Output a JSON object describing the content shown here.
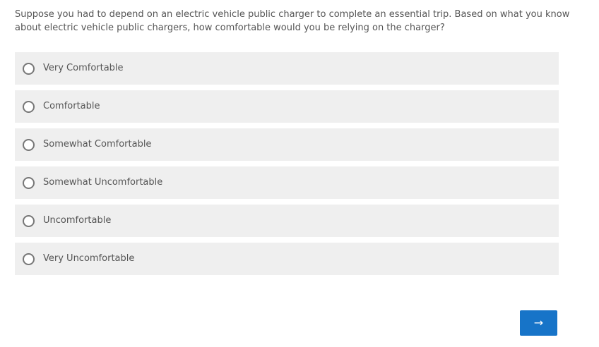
{
  "question": {
    "text": "Suppose you had to depend on an electric vehicle public charger to complete an essential trip. Based on what you know about electric vehicle public chargers, how comfortable would you be relying on the charger?"
  },
  "options": [
    {
      "label": "Very Comfortable"
    },
    {
      "label": "Comfortable"
    },
    {
      "label": "Somewhat Comfortable"
    },
    {
      "label": "Somewhat Uncomfortable"
    },
    {
      "label": "Uncomfortable"
    },
    {
      "label": "Very Uncomfortable"
    }
  ],
  "navigation": {
    "next_label": "→",
    "next_icon": "arrow-right-icon"
  },
  "colors": {
    "accent": "#1774c8",
    "option_background": "#efefef",
    "text": "#555555",
    "radio_border": "#777777"
  }
}
